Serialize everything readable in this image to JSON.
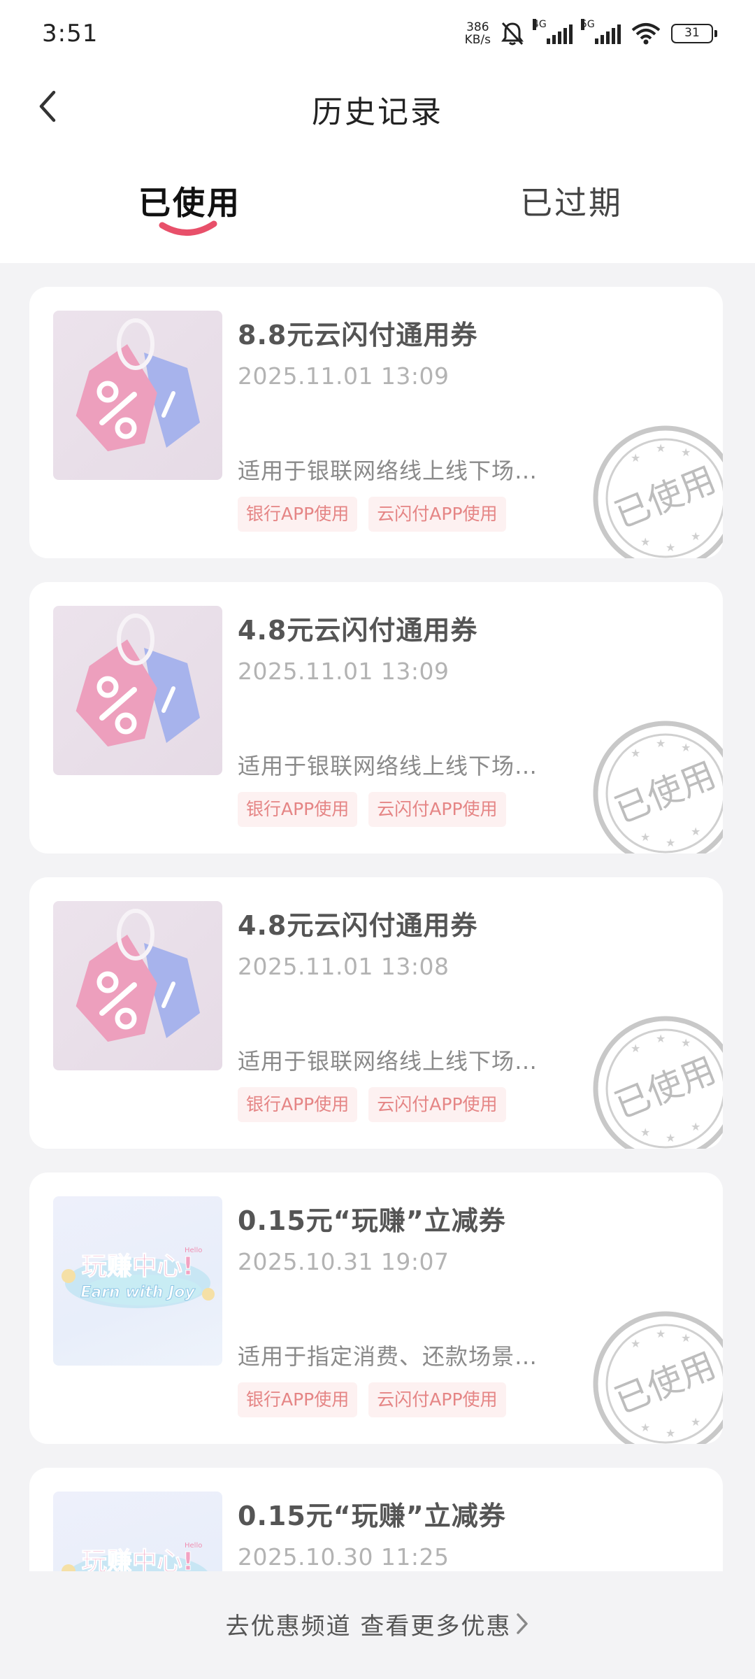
{
  "status": {
    "time": "3:51",
    "net_speed_value": "386",
    "net_speed_unit": "KB/s",
    "sim1_tag": "4G",
    "sim2_tag": "5G",
    "battery": "31"
  },
  "nav": {
    "title": "历史记录"
  },
  "tabs": [
    {
      "label": "已使用",
      "active": true
    },
    {
      "label": "已过期",
      "active": false
    }
  ],
  "coupons": [
    {
      "title": "8.8元云闪付通用券",
      "time": "2025.11.01 13:09",
      "desc": "适用于银联网络线上线下场…",
      "badges": [
        "银行APP使用",
        "云闪付APP使用"
      ],
      "image": "discount-tag-image",
      "stamp": "已使用"
    },
    {
      "title": "4.8元云闪付通用券",
      "time": "2025.11.01 13:09",
      "desc": "适用于银联网络线上线下场…",
      "badges": [
        "银行APP使用",
        "云闪付APP使用"
      ],
      "image": "discount-tag-image",
      "stamp": "已使用"
    },
    {
      "title": "4.8元云闪付通用券",
      "time": "2025.11.01 13:08",
      "desc": "适用于银联网络线上线下场…",
      "badges": [
        "银行APP使用",
        "云闪付APP使用"
      ],
      "image": "discount-tag-image",
      "stamp": "已使用"
    },
    {
      "title": "0.15元“玩赚”立减券",
      "time": "2025.10.31 19:07",
      "desc": "适用于指定消费、还款场景…",
      "badges": [
        "银行APP使用",
        "云闪付APP使用"
      ],
      "image": "earn-with-joy-image",
      "image_text_cn": "玩赚中心!",
      "image_text_en": "Earn with Joy",
      "image_text_hello": "Hello",
      "stamp": "已使用"
    },
    {
      "title": "0.15元“玩赚”立减券",
      "time": "2025.10.30 11:25",
      "desc": "",
      "badges": [],
      "image": "earn-with-joy-image",
      "image_text_cn": "玩赚中心!",
      "image_text_en": "",
      "image_text_hello": "Hello",
      "stamp": ""
    }
  ],
  "footer": {
    "link_text": "去优惠频道 查看更多优惠"
  },
  "colors": {
    "accent_underline": "#e8506a",
    "badge_text": "#e58585",
    "stamp_gray": "#c4c4c4"
  }
}
